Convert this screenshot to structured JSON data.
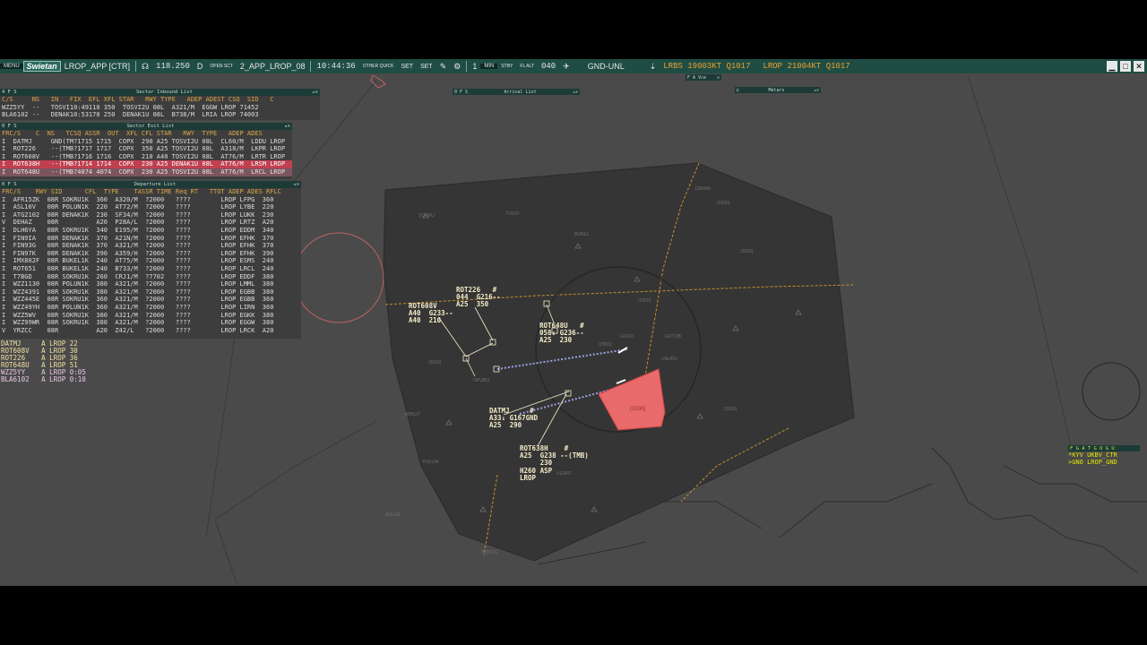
{
  "toolbar": {
    "menu": "MENU",
    "logo": "Swietan",
    "sector": "LROP_APP [CTR]",
    "freq": "118.250",
    "mode": "D",
    "open_sct": "OPEN SCT",
    "profile": "2_APP_LROP_08",
    "time": "10:44:36",
    "other_quick": "OTHER QUICK",
    "set1": "SET",
    "set2": "SET",
    "level_count": "1",
    "min": "MIN",
    "stby": "STBY",
    "fl_alt": "FL ALT",
    "alt": "040",
    "range": "GND-UNL",
    "wx1": "LRBS 19003KT Q1017",
    "wx2": "LROP 21004KT Q1017",
    "btn_min": "▁",
    "btn_max": "□",
    "btn_close": "✕"
  },
  "inbound": {
    "title": "Sector Inbound List",
    "tag": "4 F S",
    "cols": "C/S     NS   IN   FIX  EFL XFL STAR   RWY TYPE   ADEP ADEST CSQ  SID   C",
    "rows": [
      "WZZ5YY  --   TOSVI10:49110 350  TOSVI2U 08L  A321/M  EGGW LROP 71452",
      "BLA6102 --   DENAK10:53170 250  DENAK1U 08L  B738/M  LRIA LROP 74003"
    ]
  },
  "exit": {
    "title": "Sector Exit List",
    "tag": "0 F S",
    "cols": "FRC/S    C  NS   TCSQ ASSR  OUT  XFL CFL STAR   RWY  TYPE   ADEP ADES",
    "rows": [
      "I  DATMJ     GND(TM?1715 1715  COPX  290 A25 TOSVI2U 08L  CL60/M  LDDU LROP",
      "I  ROT226    --(TMB?1717 1717  COPX  350 A25 TOSVI2U 08L  A318/M  LKPR LROP",
      "I  ROT608V   --(TMB?1716 1716  COPX  210 A40 TOSVI2U 08L  AT76/M  LRTR LROP",
      "I  ROT638H   --(TMB?1714 1714  COPX  230 A25 DENAK1U 08L  AT76/M  LRSM LROP",
      "I  ROT648U   --(TMB?4074 4074  COPX  230 A25 TOSVI2U 08L  AT76/M  LRCL LROP"
    ]
  },
  "departure": {
    "title": "Departure List",
    "tag": "0 F S",
    "cols": "FRC/S    RWY SID      CFL  TYPE    TASSR TIME Req RT   TTOT ADEP ADES RFLC",
    "rows": [
      "I  AFR15ZK  08R SOKRU1K  360  A320/M  ?2000   ????        LROP LFPG  360",
      "I  ASL10V   08R POLUN1K  220  AT72/M  ?2000   ????        LROP LYBE  220",
      "I  ATG2102  08R DENAK1K  230  SF34/M  ?2000   ????        LROP LUKK  230",
      "V  DEHAZ    08R          A20  P28A/L  ?2000   ????        LROP LRTZ  A20",
      "I  DLH6YA   08R SOKRU1K  340  E195/M  ?2000   ????        LROP EDDM  340",
      "I  FIN9IA   08R DENAK1K  370  A21N/M  ?2000   ????        LROP EFHK  370",
      "I  FIN93G   08R DENAK1K  370  A321/M  ?2000   ????        LROP EFHK  370",
      "I  FIN97K   08R DENAK1K  390  A359/H  ?2000   ????        LROP EFHK  390",
      "I  IMX802F  08R BUKEL1K  240  AT75/M  ?2000   ????        LROP ESMS  240",
      "I  ROT651   08R BUKEL1K  240  B733/M  ?2000   ????        LROP LRCL  240",
      "I  T7BGD    08R SOKRU1K  260  CRJ1/M  ?7702   ????        LROP EDDF  380",
      "I  WZZ1130  08R POLUN1K  380  A321/M  ?2000   ????        LROP LMML  380",
      "I  WZZ4391  08R SOKRU1K  380  A321/M  ?2000   ????        LROP EGBB  380",
      "I  WZZ445E  08R SOKRU1K  360  A321/M  ?2000   ????        LROP EGBB  360",
      "I  WZZ49YH  08R POLUN1K  360  A321/M  ?2000   ????        LROP LIRN  360",
      "I  WZZ5WV   08R SOKRU1K  380  A321/M  ?2000   ????        LROP EGKK  380",
      "I  WZZ99WR  08R SOKRU1K  380  A321/M  ?2000   ????        LROP EGGW  380",
      "V  YRZCC    08R          A20  Z42/L   ?2000   ????        LROP LRCK  A20"
    ]
  },
  "holding": [
    {
      "text": "DATMJ     A LROP 22",
      "pink": false
    },
    {
      "text": "ROT608V   A LROP 30",
      "pink": false
    },
    {
      "text": "ROT226    A LROP 36",
      "pink": false
    },
    {
      "text": "ROT648U   A LROP 51",
      "pink": false
    },
    {
      "text": "WZZ5YY    A LROP 0:05",
      "pink": true
    },
    {
      "text": "BLA6102   A LROP 0:10",
      "pink": true
    }
  ],
  "mini_windows": {
    "arrival": "Arrival List",
    "arrival_tag": "0 F S",
    "vce": "F A Vce",
    "metars": "Metars"
  },
  "atc_box": {
    "hdr": "F G A T G O G U",
    "line1": "*KYV UKBV_CTR",
    "line2": ">GNO LROP_GND"
  },
  "aircraft": [
    {
      "id": "ROT226",
      "l1": "ROT226   #",
      "l2": "044  G216--",
      "l3": "A25  350"
    },
    {
      "id": "ROT608V",
      "l1": "ROT608V",
      "l2": "A40  G233--",
      "l3": "A40  210"
    },
    {
      "id": "ROT648U",
      "l1": "ROT648U   #",
      "l2": "058↓ G236--",
      "l3": "A25  230"
    },
    {
      "id": "DATMJ",
      "l1": "DATMJ     #",
      "l2": "A33↓ G167GND",
      "l3": "A25  290"
    },
    {
      "id": "ROT638H",
      "l1": "ROT638H    #",
      "l2": "A25  G238 --(TMB)",
      "l3": "     230",
      "l4": "H260 ASP",
      "l5": "LROP"
    }
  ],
  "waypoints": [
    "DENAK",
    "SOKRU",
    "POLUN",
    "BUKEL",
    "TOSVI",
    "GOTOB",
    "GULPI",
    "ABRUT",
    "OPUBO",
    "UGIRO",
    "UNURU",
    "ASLUS",
    "BONOS"
  ],
  "restricted_area_label": "(2000)",
  "altitude_labels": [
    "(2500)",
    "(2000)",
    "(2500)",
    "(2000)",
    "(2000)",
    "(2800)"
  ],
  "colors": {
    "toolbar": "#1f4d44",
    "scope": "#4a4a4a",
    "sector": "#3a3a3a",
    "restricted": "#e86a6a",
    "boundary": "#c8902a",
    "label": "#f4ecc8",
    "weather": "#f0a030"
  }
}
